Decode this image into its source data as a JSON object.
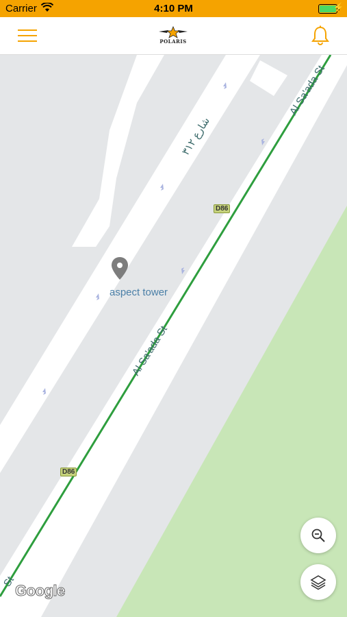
{
  "status_bar": {
    "carrier": "Carrier",
    "time": "4:10 PM"
  },
  "navbar": {
    "menu_icon": "hamburger-menu-icon",
    "logo_text": "POLARIS",
    "notification_icon": "bell-icon"
  },
  "map": {
    "poi": {
      "name": "aspect tower",
      "icon": "map-pin-icon"
    },
    "streets": [
      {
        "name": "Al Sa'ada St"
      },
      {
        "name": "Al Sa'ada St"
      },
      {
        "name": "St"
      },
      {
        "name": "شارع ٣١٢"
      }
    ],
    "route_shields": [
      "D86",
      "D86"
    ],
    "attribution": "Google",
    "route_color": "#2e9e3e",
    "park_color": "#c8e6b7"
  },
  "controls": {
    "zoom_out_icon": "zoom-out-icon",
    "layers_icon": "layers-icon"
  }
}
